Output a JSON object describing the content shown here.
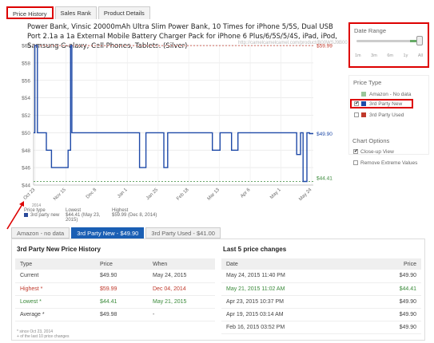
{
  "top_tabs": [
    "Price History",
    "Sales Rank",
    "Product Details"
  ],
  "product_title": "Power Bank, Vinsic 20000mAh Ultra Slim Power Bank, 10 Times for iPhone 5/5S, Dual USB Port 2.1a a 1a External Mobile Battery Charger Pack for iPhone 6 Plus/6/5S/5/4S, iPad, iPod, Samsung G-alaxy, Cell Phones, Tablets. (Silver)",
  "watermark": "http://camelcamelcamel.com/product/B00WSJ9B00",
  "chart_data": {
    "type": "line",
    "title": "",
    "xlabel": "",
    "ylabel": "",
    "ylim": [
      44,
      60
    ],
    "y_ticks": [
      "$60",
      "$58",
      "$56",
      "$54",
      "$52",
      "$50",
      "$48",
      "$46",
      "$44"
    ],
    "x_ticks": [
      "Oct 23",
      "Nov 15",
      "Dec 8",
      "Jan 1",
      "Jan 25",
      "Feb 18",
      "Mar 13",
      "Apr 6",
      "May 1",
      "May 24"
    ],
    "x_year_label": "2014",
    "series": [
      {
        "name": "3rd party new",
        "color": "#1f4aa8",
        "points": [
          [
            0,
            50
          ],
          [
            1,
            50
          ],
          [
            1,
            59.99
          ],
          [
            3,
            59.99
          ],
          [
            3,
            50
          ],
          [
            10,
            50
          ],
          [
            10,
            48
          ],
          [
            14,
            48
          ],
          [
            14,
            46
          ],
          [
            27,
            46
          ],
          [
            27,
            48
          ],
          [
            29,
            48
          ],
          [
            29,
            59.99
          ],
          [
            30,
            59.99
          ],
          [
            30,
            50
          ],
          [
            83,
            50
          ],
          [
            83,
            46
          ],
          [
            88,
            46
          ],
          [
            88,
            50
          ],
          [
            102,
            50
          ],
          [
            102,
            46
          ],
          [
            105,
            46
          ],
          [
            105,
            50
          ],
          [
            140,
            50
          ],
          [
            140,
            48
          ],
          [
            146,
            48
          ],
          [
            146,
            50
          ],
          [
            155,
            50
          ],
          [
            155,
            48
          ],
          [
            160,
            48
          ],
          [
            160,
            50
          ],
          [
            206,
            50
          ],
          [
            206,
            47.5
          ],
          [
            209,
            47.5
          ],
          [
            209,
            50
          ],
          [
            211,
            50
          ],
          [
            211,
            44.41
          ],
          [
            214,
            44.41
          ],
          [
            214,
            50
          ],
          [
            216,
            50
          ],
          [
            216,
            49.9
          ],
          [
            219,
            49.9
          ]
        ]
      }
    ],
    "annotations": {
      "highest": "$59.99",
      "lowest": "$44.41",
      "current": "$49.90",
      "highest_color": "#c0392b",
      "lowest_color": "#3a8a3a",
      "current_color": "#1f4aa8"
    },
    "grid": true
  },
  "stats": {
    "headers": [
      "Price type",
      "Lowest",
      "Highest"
    ],
    "series_label": "3rd party new",
    "lowest": "$44.41 (May 23, 2015)",
    "highest": "$59.99 (Dec 8, 2014)"
  },
  "side": {
    "date_range_title": "Date Range",
    "range_labels": [
      "1m",
      "3m",
      "6m",
      "1y",
      "All"
    ],
    "range_selected_fraction": 1.0,
    "price_type_title": "Price Type",
    "price_types": [
      {
        "label": "Amazon - No data",
        "color": "#9bc69b",
        "checked": false,
        "disabled": true
      },
      {
        "label": "3rd Party New",
        "color": "#1f4aa8",
        "checked": true,
        "disabled": false
      },
      {
        "label": "3rd Party Used",
        "color": "#c0392b",
        "checked": false,
        "disabled": false
      }
    ],
    "chart_options_title": "Chart Options",
    "options": [
      {
        "label": "Close-up View",
        "checked": true
      },
      {
        "label": "Remove Extreme Values",
        "checked": false
      }
    ]
  },
  "bottom_tabs": [
    "Amazon - no data",
    "3rd Party New - $49.90",
    "3rd Party Used - $41.00"
  ],
  "history": {
    "title": "3rd Party New Price History",
    "headers": [
      "Type",
      "Price",
      "When"
    ],
    "rows": [
      {
        "type": "Current",
        "price": "$49.90",
        "when": "May 24, 2015",
        "style": ""
      },
      {
        "type": "Highest *",
        "price": "$59.99",
        "when": "Dec 04, 2014",
        "style": "red"
      },
      {
        "type": "Lowest *",
        "price": "$44.41",
        "when": "May 21, 2015",
        "style": "green"
      },
      {
        "type": "Average *",
        "price": "$49.98",
        "when": "-",
        "style": ""
      }
    ],
    "footnote": [
      "* since Oct 23, 2014",
      "+ of the last 10 price changes"
    ]
  },
  "changes": {
    "title": "Last 5 price changes",
    "headers": [
      "Date",
      "Price"
    ],
    "rows": [
      {
        "date": "May 24, 2015 11:40 PM",
        "price": "$49.90",
        "style": ""
      },
      {
        "date": "May 21, 2015 11:02 AM",
        "price": "$44.41",
        "style": "green"
      },
      {
        "date": "Apr 23, 2015 10:37 PM",
        "price": "$49.90",
        "style": ""
      },
      {
        "date": "Apr 19, 2015 03:14 AM",
        "price": "$49.90",
        "style": ""
      },
      {
        "date": "Feb 16, 2015 03:52 PM",
        "price": "$49.90",
        "style": ""
      }
    ]
  }
}
